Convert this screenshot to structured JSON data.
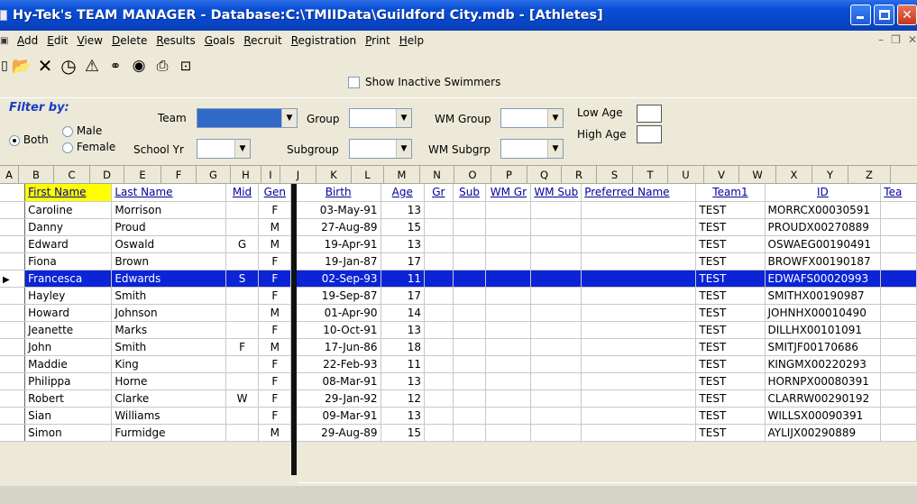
{
  "window": {
    "title": "Hy-Tek's TEAM MANAGER - Database:C:\\TMIIData\\Guildford City.mdb - [Athletes]"
  },
  "menu": {
    "items": [
      "Add",
      "Edit",
      "View",
      "Delete",
      "Results",
      "Goals",
      "Recruit",
      "Registration",
      "Print",
      "Help"
    ]
  },
  "toolbar": {
    "icons": [
      "new-icon",
      "open-folder-icon",
      "delete-x-icon",
      "clock-icon",
      "warning-icon",
      "binoculars-icon",
      "eye-icon",
      "printer-icon",
      "export-icon"
    ],
    "show_inactive_label": "Show Inactive Swimmers"
  },
  "filter": {
    "title": "Filter by:",
    "both_label": "Both",
    "male_label": "Male",
    "female_label": "Female",
    "team_label": "Team",
    "school_yr_label": "School Yr",
    "group_label": "Group",
    "subgroup_label": "Subgroup",
    "wm_group_label": "WM Group",
    "wm_subgrp_label": "WM Subgrp",
    "low_age_label": "Low Age",
    "high_age_label": "High Age"
  },
  "column_letters": [
    "A",
    "B",
    "C",
    "D",
    "E",
    "F",
    "G",
    "H",
    "I",
    "J",
    "K",
    "L",
    "M",
    "N",
    "O",
    "P",
    "Q",
    "R",
    "S",
    "T",
    "U",
    "V",
    "W",
    "X",
    "Y",
    "Z"
  ],
  "grid": {
    "headers": {
      "first": "First Name",
      "last": "Last Name",
      "mid": "Mid",
      "gen": "Gen",
      "birth": "Birth",
      "age": "Age",
      "gr": "Gr",
      "sub": "Sub",
      "wmgr": "WM Gr",
      "wmsub": "WM Sub",
      "pref": "Preferred Name",
      "team1": "Team1",
      "id": "ID",
      "team2": "Tea"
    },
    "rows": [
      {
        "first": "Caroline",
        "last": "Morrison",
        "mid": "",
        "gen": "F",
        "birth": "03-May-91",
        "age": "13",
        "team1": "TEST",
        "id": "MORRCX00030591"
      },
      {
        "first": "Danny",
        "last": "Proud",
        "mid": "",
        "gen": "M",
        "birth": "27-Aug-89",
        "age": "15",
        "team1": "TEST",
        "id": "PROUDX00270889"
      },
      {
        "first": "Edward",
        "last": "Oswald",
        "mid": "G",
        "gen": "M",
        "birth": "19-Apr-91",
        "age": "13",
        "team1": "TEST",
        "id": "OSWAEG00190491"
      },
      {
        "first": "Fiona",
        "last": "Brown",
        "mid": "",
        "gen": "F",
        "birth": "19-Jan-87",
        "age": "17",
        "team1": "TEST",
        "id": "BROWFX00190187"
      },
      {
        "first": "Francesca",
        "last": "Edwards",
        "mid": "S",
        "gen": "F",
        "birth": "02-Sep-93",
        "age": "11",
        "team1": "TEST",
        "id": "EDWAFS00020993",
        "selected": true
      },
      {
        "first": "Hayley",
        "last": "Smith",
        "mid": "",
        "gen": "F",
        "birth": "19-Sep-87",
        "age": "17",
        "team1": "TEST",
        "id": "SMITHX00190987"
      },
      {
        "first": "Howard",
        "last": "Johnson",
        "mid": "",
        "gen": "M",
        "birth": "01-Apr-90",
        "age": "14",
        "team1": "TEST",
        "id": "JOHNHX00010490"
      },
      {
        "first": "Jeanette",
        "last": "Marks",
        "mid": "",
        "gen": "F",
        "birth": "10-Oct-91",
        "age": "13",
        "team1": "TEST",
        "id": "DILLHX00101091"
      },
      {
        "first": "John",
        "last": "Smith",
        "mid": "F",
        "gen": "M",
        "birth": "17-Jun-86",
        "age": "18",
        "team1": "TEST",
        "id": "SMITJF00170686"
      },
      {
        "first": "Maddie",
        "last": "King",
        "mid": "",
        "gen": "F",
        "birth": "22-Feb-93",
        "age": "11",
        "team1": "TEST",
        "id": "KINGMX00220293"
      },
      {
        "first": "Philippa",
        "last": "Horne",
        "mid": "",
        "gen": "F",
        "birth": "08-Mar-91",
        "age": "13",
        "team1": "TEST",
        "id": "HORNPX00080391"
      },
      {
        "first": "Robert",
        "last": "Clarke",
        "mid": "W",
        "gen": "F",
        "birth": "29-Jan-92",
        "age": "12",
        "team1": "TEST",
        "id": "CLARRW00290192"
      },
      {
        "first": "Sian",
        "last": "Williams",
        "mid": "",
        "gen": "F",
        "birth": "09-Mar-91",
        "age": "13",
        "team1": "TEST",
        "id": "WILLSX00090391"
      },
      {
        "first": "Simon",
        "last": "Furmidge",
        "mid": "",
        "gen": "M",
        "birth": "29-Aug-89",
        "age": "15",
        "team1": "TEST",
        "id": "AYLIJX00290889"
      }
    ]
  }
}
